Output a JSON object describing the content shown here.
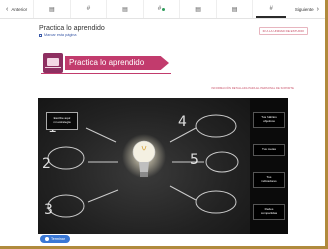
{
  "nav": {
    "prev_label": "Anterior",
    "next_label": "Siguiente",
    "tabs": [
      {
        "glyph": "▤",
        "active": false
      },
      {
        "glyph": "#",
        "active": false
      },
      {
        "glyph": "▤",
        "active": false
      },
      {
        "glyph": "#",
        "active": false,
        "done": true
      },
      {
        "glyph": "▤",
        "active": false
      },
      {
        "glyph": "▤",
        "active": false
      },
      {
        "glyph": "#",
        "active": true
      }
    ]
  },
  "header": {
    "title": "Practica lo aprendido",
    "mark_page_label": "Marcar esta página",
    "unit_button": "IR A LA UNIDAD DE ESTUDIO"
  },
  "banner": {
    "label": "Practica lo aprendido"
  },
  "info_link": "INFORMACIÓN DETALLADA PARA EL PERSONAL DE SOPORTE",
  "board": {
    "step_box": "Escribe aquí\nmi estrategia",
    "panel_buttons": [
      "Tus hábitos\nobjetivos",
      "Tus metas",
      "Tus\nindicadores",
      "Redes\ncompartidas"
    ],
    "numbers": [
      "1",
      "2",
      "3",
      "4",
      "5"
    ]
  },
  "footer": {
    "finish_label": "Terminar"
  },
  "colors": {
    "brand": "#c23b6d",
    "brand_dark": "#8e2f61",
    "primary_button": "#3a78d6",
    "frame_border": "#b08a3c"
  }
}
